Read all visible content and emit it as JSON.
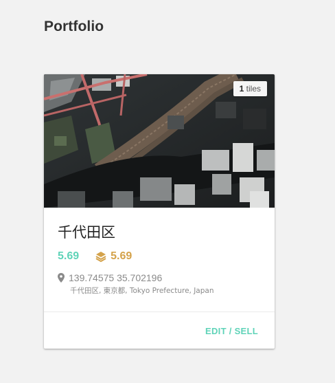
{
  "page": {
    "title": "Portfolio"
  },
  "card": {
    "image_icon": "aerial-city-photo",
    "tiles_count": "1",
    "tiles_label": "tiles",
    "name": "千代田区",
    "price": "5.69",
    "layers_value": "5.69",
    "layers_icon": "layers-icon",
    "location_icon": "map-pin-icon",
    "coordinates": "139.74575 35.702196",
    "address": "千代田区, 東京都, Tokyo Prefecture, Japan",
    "action_label": "EDIT / SELL"
  },
  "colors": {
    "accent": "#5fd3b8",
    "gold": "#d4a24a",
    "muted": "#8a8a8a",
    "background": "#f2f2f2"
  }
}
